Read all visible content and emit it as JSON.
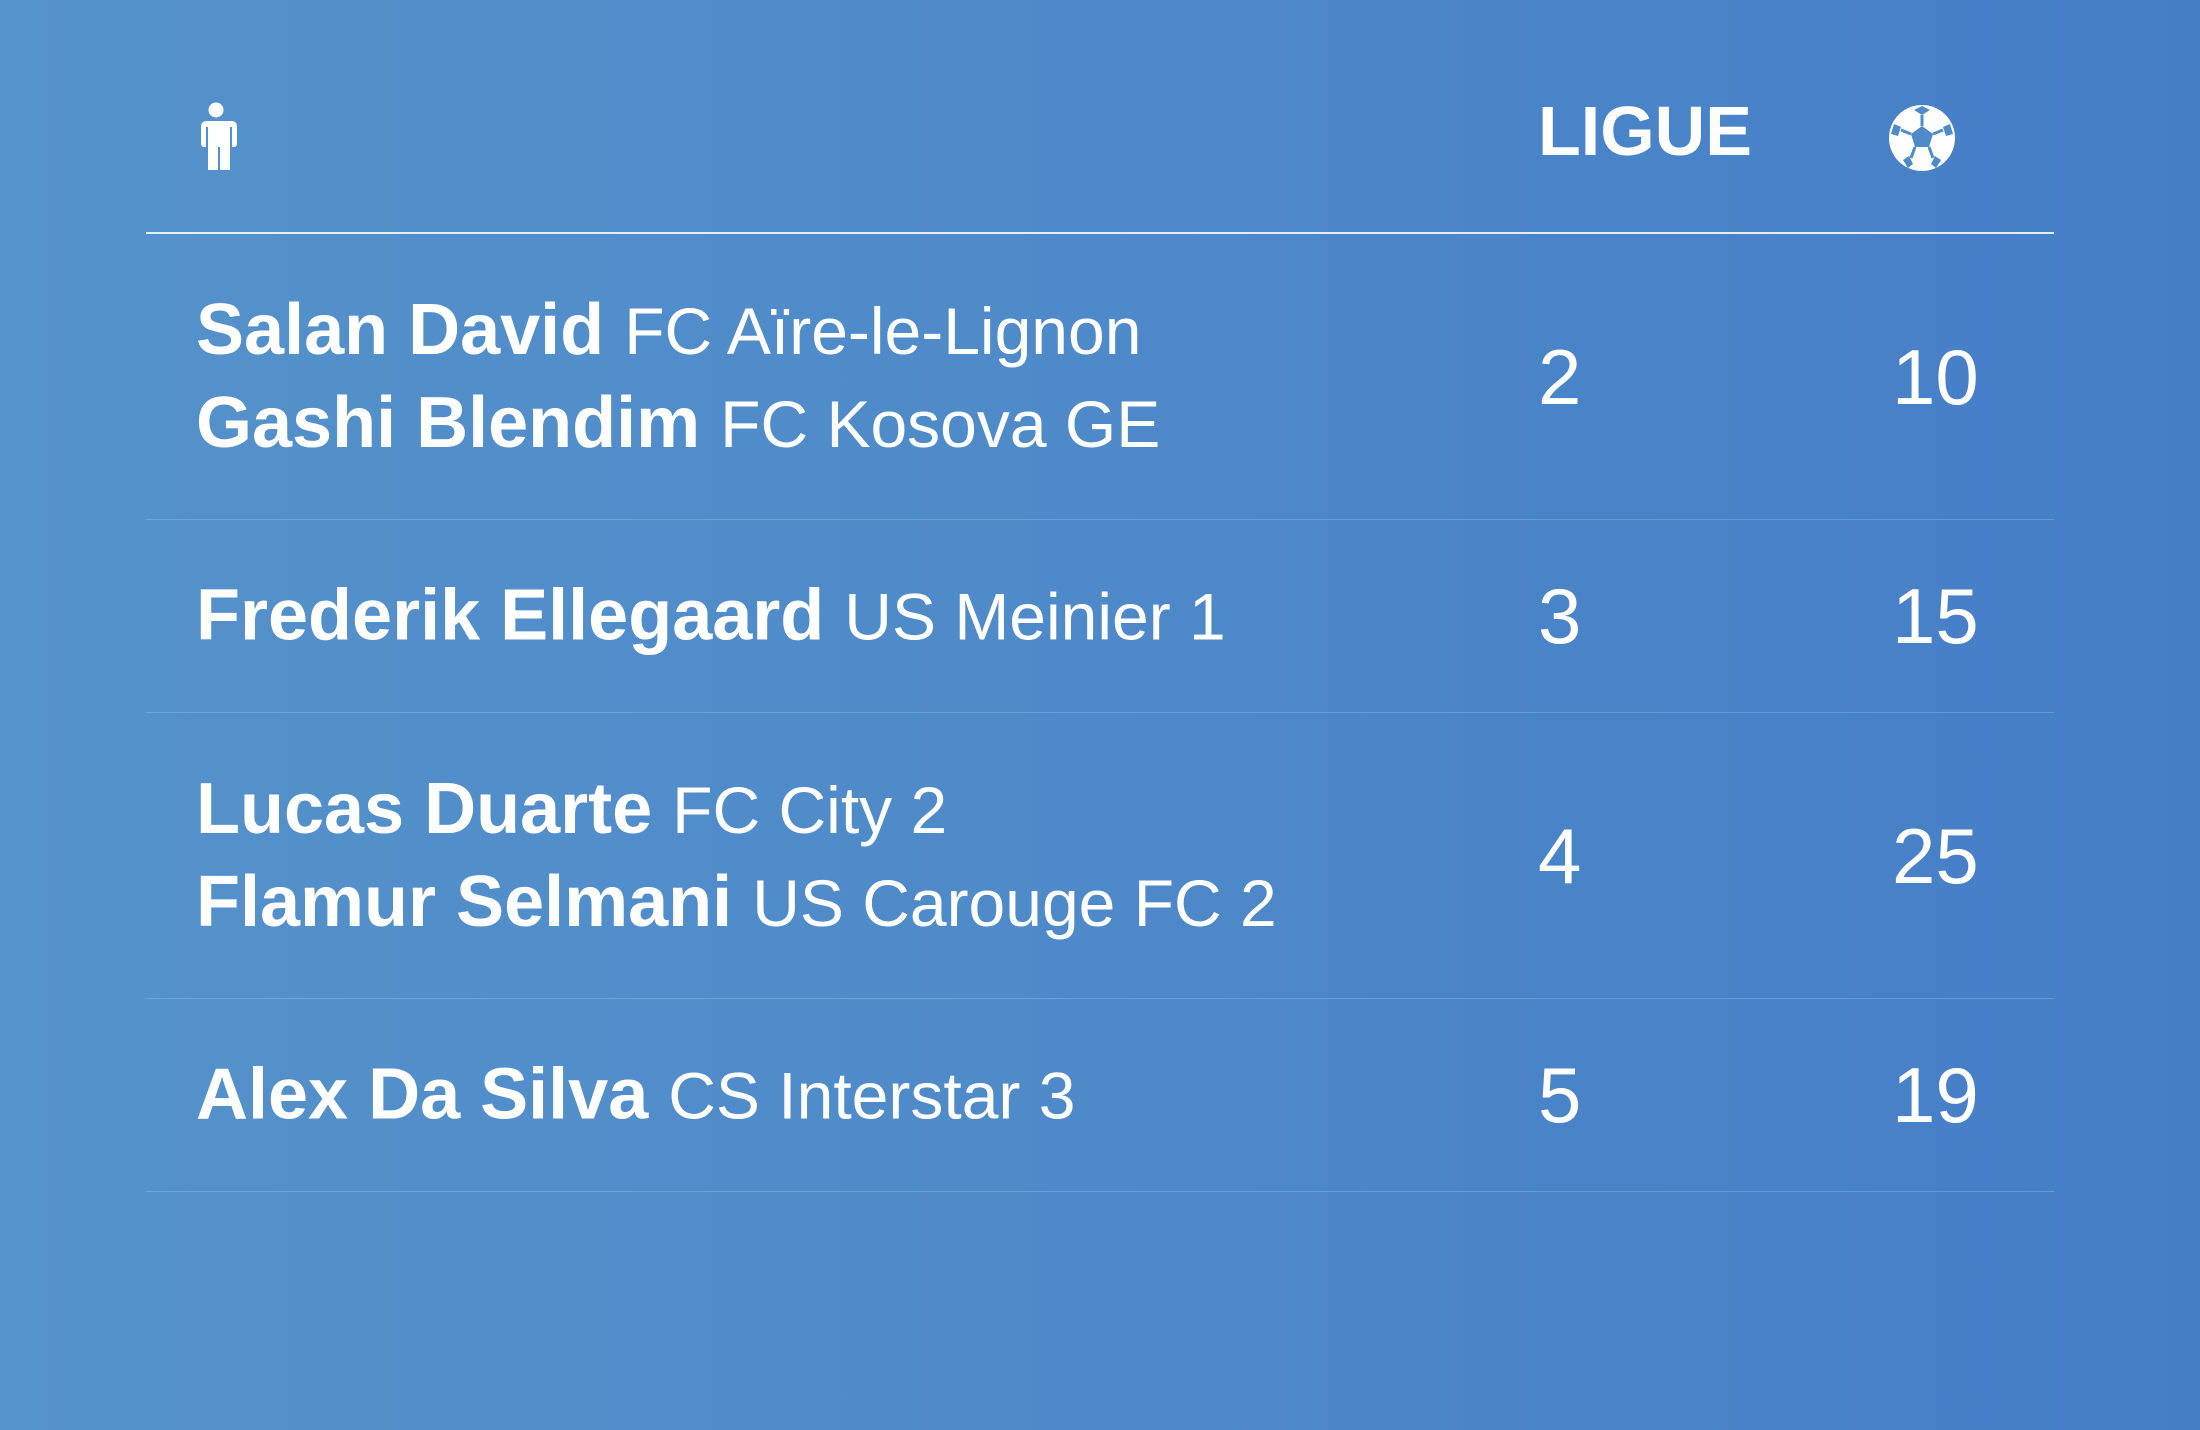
{
  "header": {
    "ligue_label": "LIGUE",
    "player_icon": "person-icon",
    "goals_icon": "soccer-ball-icon"
  },
  "rows": [
    {
      "players": [
        {
          "name": "Salan David",
          "club": "FC Aïre-le-Lignon"
        },
        {
          "name": "Gashi Blendim",
          "club": "FC Kosova GE"
        }
      ],
      "ligue": "2",
      "goals": "10"
    },
    {
      "players": [
        {
          "name": "Frederik Ellegaard",
          "club": "US Meinier 1"
        }
      ],
      "ligue": "3",
      "goals": "15"
    },
    {
      "players": [
        {
          "name": "Lucas Duarte",
          "club": "FC City 2"
        },
        {
          "name": "Flamur Selmani",
          "club": "US Carouge FC 2"
        }
      ],
      "ligue": "4",
      "goals": "25"
    },
    {
      "players": [
        {
          "name": "Alex Da Silva",
          "club": "CS Interstar 3"
        }
      ],
      "ligue": "5",
      "goals": "19"
    }
  ],
  "colors": {
    "background_start": "#5593cb",
    "background_end": "#457ec7",
    "text": "#ffffff"
  }
}
